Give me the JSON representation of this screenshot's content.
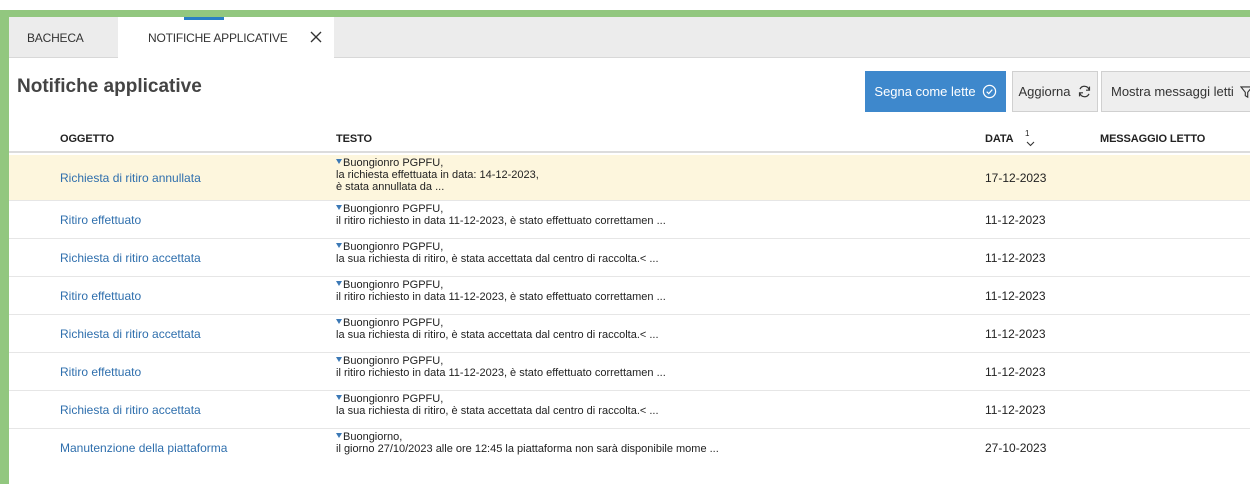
{
  "tabs": [
    {
      "label": "BACHECA"
    },
    {
      "label": "NOTIFICHE APPLICATIVE"
    }
  ],
  "page_title": "Notifiche applicative",
  "toolbar": {
    "mark_read_label": "Segna come lette",
    "refresh_label": "Aggiorna",
    "show_read_label": "Mostra messaggi letti"
  },
  "table": {
    "columns": {
      "oggetto": "OGGETTO",
      "testo": "TESTO",
      "data": "DATA",
      "sort_index": "1",
      "letto": "MESSAGGIO LETTO"
    },
    "rows": [
      {
        "oggetto": "Richiesta di ritiro annullata",
        "testo": [
          "Buongionro PGPFU,",
          "la richiesta effettuata in data: 14-12-2023,",
          "è stata annullata da ..."
        ],
        "data": "17-12-2023"
      },
      {
        "oggetto": "Ritiro effettuato",
        "testo": [
          "Buongionro PGPFU,",
          "il ritiro richiesto in data 11-12-2023, è stato effettuato correttamen ..."
        ],
        "data": "11-12-2023"
      },
      {
        "oggetto": "Richiesta di ritiro accettata",
        "testo": [
          "Buongionro PGPFU,",
          "la sua richiesta di ritiro, è stata accettata dal centro di raccolta.< ..."
        ],
        "data": "11-12-2023"
      },
      {
        "oggetto": "Ritiro effettuato",
        "testo": [
          "Buongionro PGPFU,",
          "il ritiro richiesto in data 11-12-2023, è stato effettuato correttamen ..."
        ],
        "data": "11-12-2023"
      },
      {
        "oggetto": "Richiesta di ritiro accettata",
        "testo": [
          "Buongionro PGPFU,",
          "la sua richiesta di ritiro, è stata accettata dal centro di raccolta.< ..."
        ],
        "data": "11-12-2023"
      },
      {
        "oggetto": "Ritiro effettuato",
        "testo": [
          "Buongionro PGPFU,",
          "il ritiro richiesto in data 11-12-2023, è stato effettuato correttamen ..."
        ],
        "data": "11-12-2023"
      },
      {
        "oggetto": "Richiesta di ritiro accettata",
        "testo": [
          "Buongionro PGPFU,",
          "la sua richiesta di ritiro, è stata accettata dal centro di raccolta.< ..."
        ],
        "data": "11-12-2023"
      },
      {
        "oggetto": "Manutenzione della piattaforma",
        "testo": [
          "Buongiorno,",
          "il giorno 27/10/2023 alle ore 12:45 la piattaforma non sarà disponibile mome ..."
        ],
        "data": "27-10-2023"
      }
    ]
  },
  "icons": {
    "close": "close-icon",
    "check_circle": "check-circle-icon",
    "refresh": "refresh-icon",
    "filter": "filter-icon",
    "sort": "chevron-down-icon",
    "expand": "caret-down-icon"
  },
  "colors": {
    "accent_green": "#92c77f",
    "primary_button": "#3e88cc",
    "link": "#2f6fad",
    "highlight_row": "#fdf6dd"
  }
}
